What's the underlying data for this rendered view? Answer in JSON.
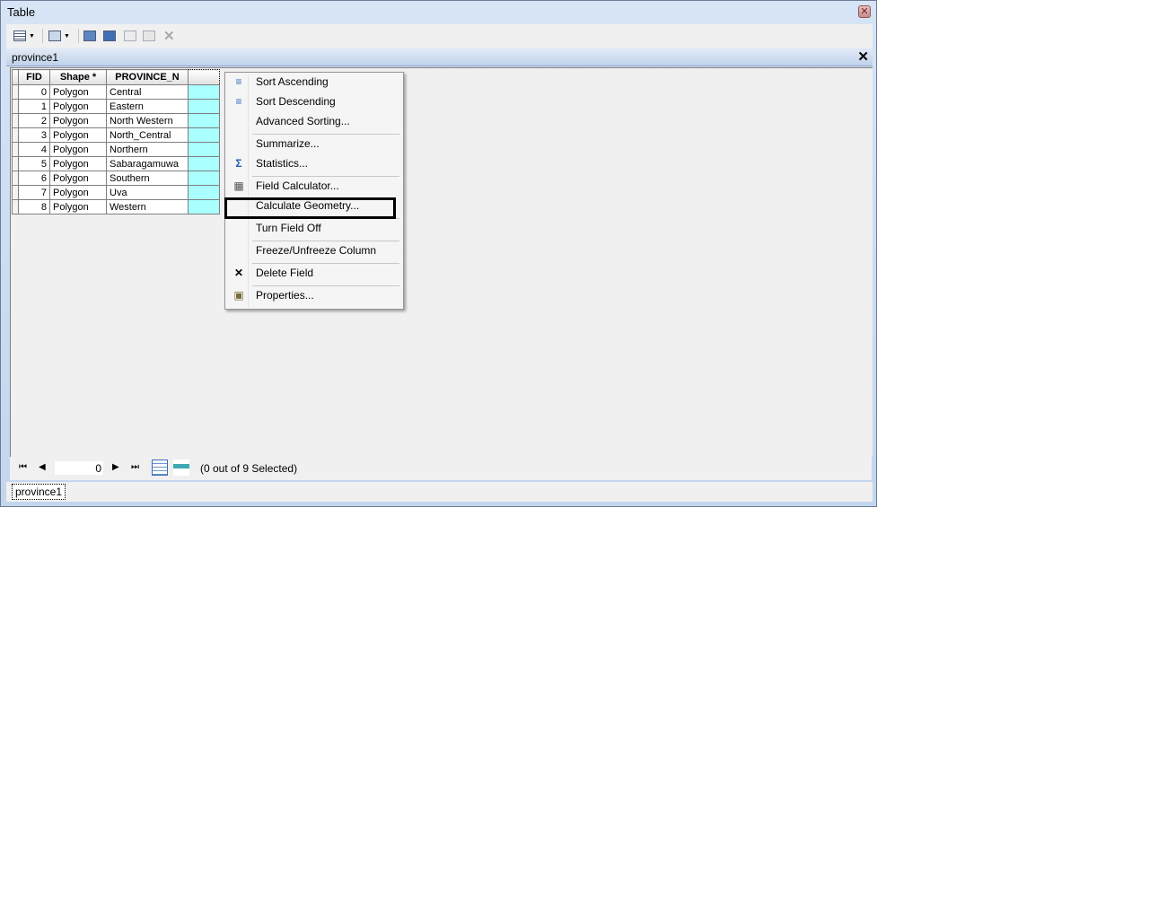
{
  "window": {
    "title": "Table"
  },
  "toolbar": {
    "icons": [
      "table-options-icon",
      "related-tables-icon",
      "select-by-attributes-icon",
      "switch-selection-icon",
      "clear-selection-icon",
      "zoom-to-selected-icon",
      "delete-selected-icon"
    ]
  },
  "panel": {
    "title": "province1"
  },
  "table": {
    "columns": [
      "FID",
      "Shape *",
      "PROVINCE_N",
      ""
    ],
    "rows": [
      {
        "fid": "0",
        "shape": "Polygon",
        "name": "Central"
      },
      {
        "fid": "1",
        "shape": "Polygon",
        "name": "Eastern"
      },
      {
        "fid": "2",
        "shape": "Polygon",
        "name": "North Western"
      },
      {
        "fid": "3",
        "shape": "Polygon",
        "name": "North_Central"
      },
      {
        "fid": "4",
        "shape": "Polygon",
        "name": "Northern"
      },
      {
        "fid": "5",
        "shape": "Polygon",
        "name": "Sabaragamuwa"
      },
      {
        "fid": "6",
        "shape": "Polygon",
        "name": "Southern"
      },
      {
        "fid": "7",
        "shape": "Polygon",
        "name": "Uva"
      },
      {
        "fid": "8",
        "shape": "Polygon",
        "name": "Western"
      }
    ],
    "selected_column_color": "#aaffff"
  },
  "context_menu": {
    "items": [
      {
        "label": "Sort Ascending",
        "icon": "sort-ascending-icon"
      },
      {
        "label": "Sort Descending",
        "icon": "sort-descending-icon"
      },
      {
        "label": "Advanced Sorting...",
        "icon": ""
      },
      {
        "label": "Summarize...",
        "icon": ""
      },
      {
        "label": "Statistics...",
        "icon": "sigma-icon"
      },
      {
        "label": "Field Calculator...",
        "icon": "calculator-icon"
      },
      {
        "label": "Calculate Geometry...",
        "icon": ""
      },
      {
        "label": "Turn Field Off",
        "icon": ""
      },
      {
        "label": "Freeze/Unfreeze Column",
        "icon": ""
      },
      {
        "label": "Delete Field",
        "icon": "delete-x-icon"
      },
      {
        "label": "Properties...",
        "icon": "properties-icon"
      }
    ]
  },
  "navigation": {
    "current_record": "0",
    "status": "(0 out of 9 Selected)"
  },
  "tabs": [
    {
      "label": "province1"
    }
  ]
}
